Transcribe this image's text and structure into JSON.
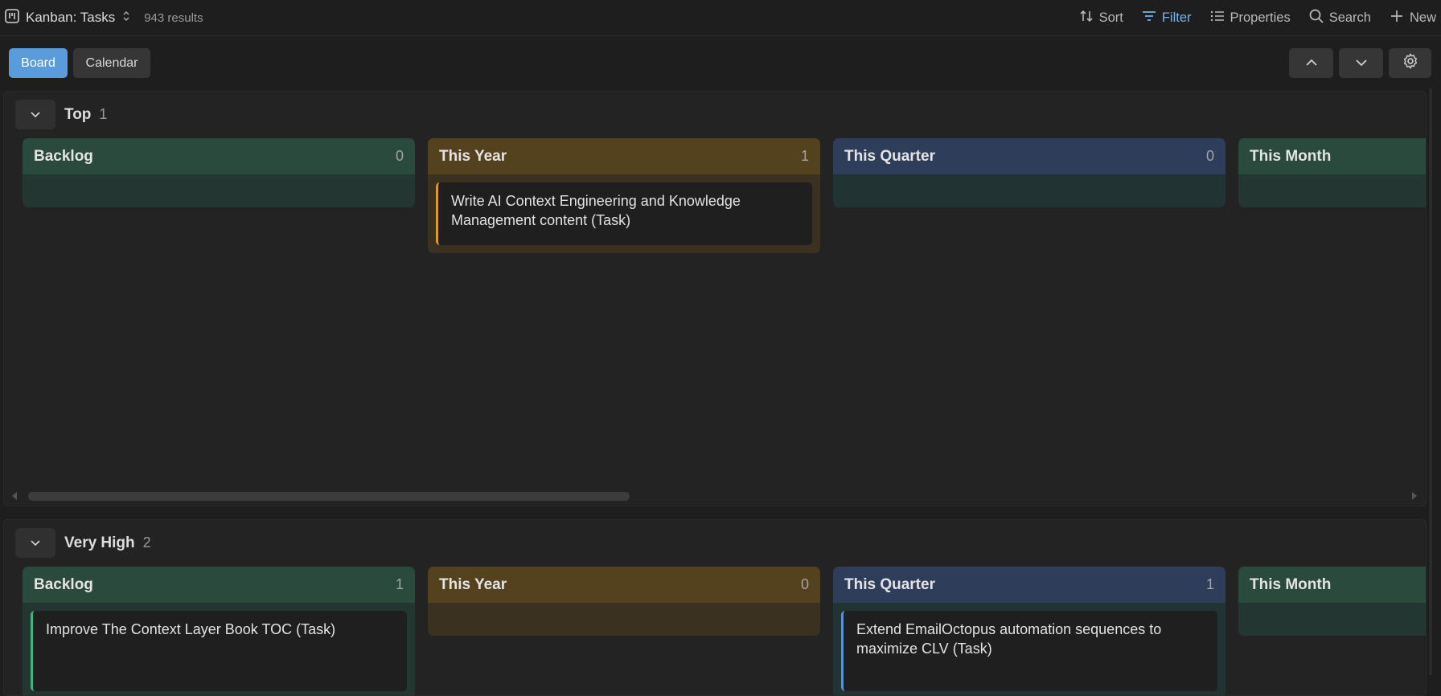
{
  "header": {
    "title": "Kanban: Tasks",
    "results": "943 results",
    "tools": {
      "sort": "Sort",
      "filter": "Filter",
      "properties": "Properties",
      "search": "Search",
      "new": "New"
    }
  },
  "view": {
    "board": "Board",
    "calendar": "Calendar"
  },
  "groups": [
    {
      "name": "Top",
      "count": "1",
      "columns": [
        {
          "title": "Backlog",
          "count": "0",
          "cards": []
        },
        {
          "title": "This Year",
          "count": "1",
          "cards": [
            "Write AI Context Engineering and Knowledge Management content (Task)"
          ]
        },
        {
          "title": "This Quarter",
          "count": "0",
          "cards": []
        },
        {
          "title": "This Month",
          "count": "",
          "cards": []
        }
      ]
    },
    {
      "name": "Very High",
      "count": "2",
      "columns": [
        {
          "title": "Backlog",
          "count": "1",
          "cards": [
            "Improve The Context Layer Book TOC (Task)"
          ]
        },
        {
          "title": "This Year",
          "count": "0",
          "cards": []
        },
        {
          "title": "This Quarter",
          "count": "1",
          "cards": [
            "Extend EmailOctopus automation sequences to maximize CLV (Task)"
          ]
        },
        {
          "title": "This Month",
          "count": "",
          "cards": []
        }
      ]
    }
  ],
  "colors": {
    "accent": "#5a9bdc",
    "filter_active": "#7ab1e6",
    "backlog": "#2a4a3e",
    "this_year": "#54421f",
    "this_quarter": "#2e3d5a"
  }
}
